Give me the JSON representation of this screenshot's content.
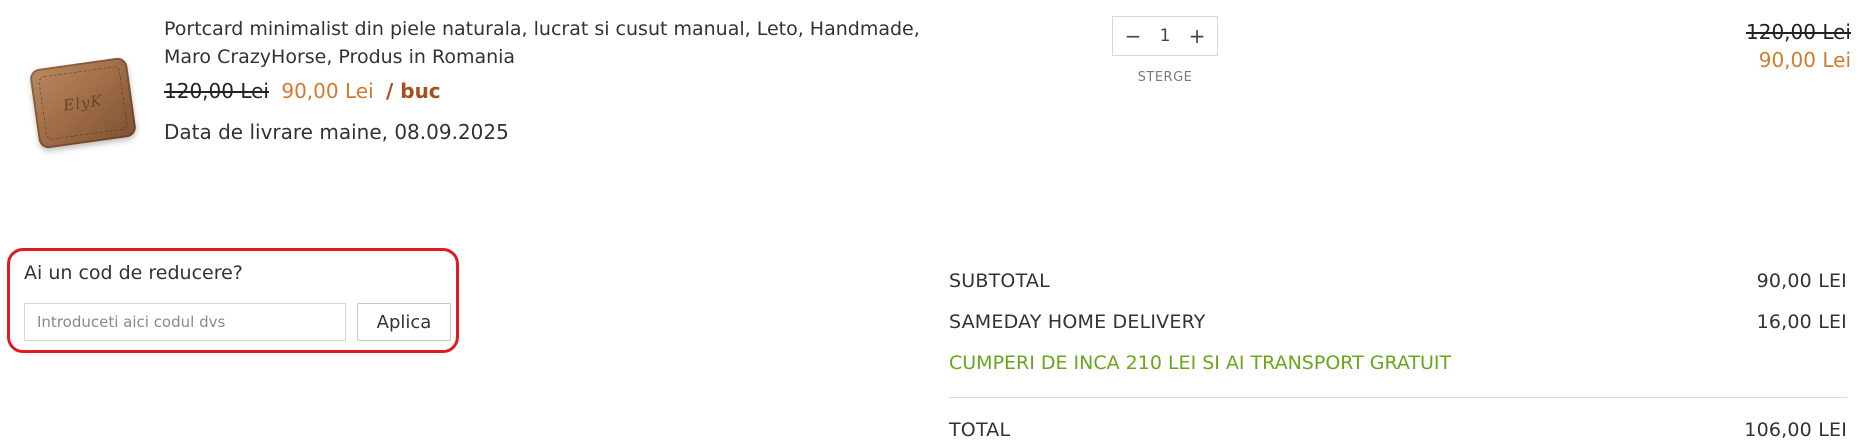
{
  "cart_item": {
    "thumbnail_icon": "leather-wallet-image",
    "thumbnail_mark": "ElyK",
    "title": "Portcard minimalist din piele naturala, lucrat si cusut manual, Leto, Handmade, Maro CrazyHorse, Produs in Romania",
    "old_price": "120,00 Lei",
    "new_price": "90,00 Lei",
    "unit_suffix": "/ buc",
    "delivery": "Data de livrare maine, 08.09.2025",
    "quantity": {
      "minus_label": "−",
      "value": "1",
      "plus_label": "+"
    },
    "remove_label": "STERGE",
    "line_old_total": "120,00 Lei",
    "line_new_total": "90,00 Lei"
  },
  "coupon": {
    "label": "Ai un cod de reducere?",
    "input_value": "",
    "placeholder": "Introduceti aici codul dvs",
    "apply_label": "Aplica"
  },
  "totals": {
    "subtotal_label": "SUBTOTAL",
    "subtotal_value": "90,00 LEI",
    "shipping_label": "SAMEDAY HOME DELIVERY",
    "shipping_value": "16,00 LEI",
    "free_shipping_notice": "CUMPERI DE INCA 210 LEI SI AI TRANSPORT GRATUIT",
    "total_label": "TOTAL",
    "total_value": "106,00 LEI"
  },
  "colors": {
    "sale_price": "#d37b2d",
    "unit_suffix": "#a4501d",
    "free_shipping": "#6aa61b",
    "coupon_highlight": "#e11b22"
  }
}
